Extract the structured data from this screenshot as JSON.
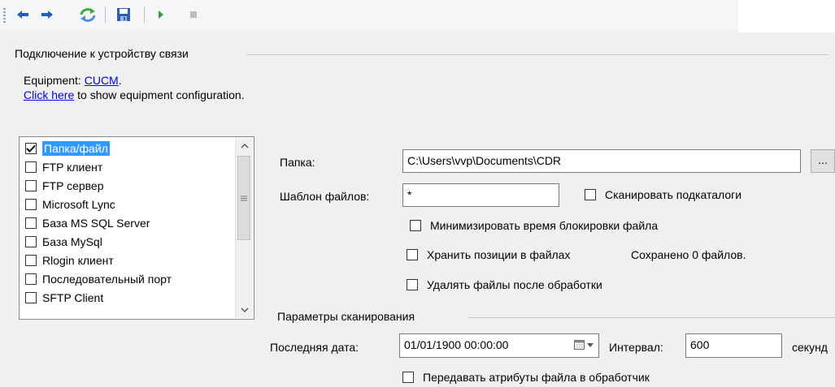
{
  "toolbar": {
    "buttons": [
      {
        "icon": "arrow-left-icon"
      },
      {
        "icon": "arrow-right-icon"
      },
      {
        "icon": "refresh-icon"
      },
      {
        "icon": "save-icon"
      },
      {
        "icon": "play-icon"
      },
      {
        "icon": "stop-icon"
      }
    ]
  },
  "connection_group": {
    "title": "Подключение к устройству связи",
    "equipment_prefix": "Equipment: ",
    "equipment_link": "CUCM",
    "equipment_suffix": ".",
    "config_link": "Click here",
    "config_suffix": " to show equipment configuration."
  },
  "source_list": {
    "items": [
      {
        "label": "Папка/файл",
        "checked": true,
        "selected": true
      },
      {
        "label": "FTP клиент",
        "checked": false
      },
      {
        "label": "FTP сервер",
        "checked": false
      },
      {
        "label": "Microsoft Lync",
        "checked": false
      },
      {
        "label": "База MS SQL Server",
        "checked": false
      },
      {
        "label": "База MySql",
        "checked": false
      },
      {
        "label": "Rlogin клиент",
        "checked": false
      },
      {
        "label": "Последовательный порт",
        "checked": false
      },
      {
        "label": "SFTP Client",
        "checked": false
      }
    ]
  },
  "folder_settings": {
    "folder_label": "Папка:",
    "folder_value": "C:\\Users\\vvp\\Documents\\CDR",
    "browse_label": "...",
    "template_label": "Шаблон файлов:",
    "template_value": "*",
    "scan_subdirs_label": "Сканировать подкаталоги",
    "minimize_lock_label": "Минимизировать время блокировки файла",
    "store_positions_label": "Хранить позиции в файлах",
    "saved_count_text": "Сохранено 0 файлов.",
    "delete_after_label": "Удалять файлы после обработки"
  },
  "scan_params": {
    "title": "Параметры сканирования",
    "last_date_label": "Последняя дата:",
    "last_date_value": "01/01/1900 00:00:00",
    "interval_label": "Интервал:",
    "interval_value": "600",
    "interval_unit": "секунд",
    "pass_attributes_label": "Передавать атрибуты файла в обработчик"
  },
  "colors": {
    "selection": "#3399ff",
    "link": "#0000ee",
    "arrow_blue": "#1f5fbf",
    "refresh_green": "#3ea63a",
    "play_green": "#2e9e2e"
  }
}
